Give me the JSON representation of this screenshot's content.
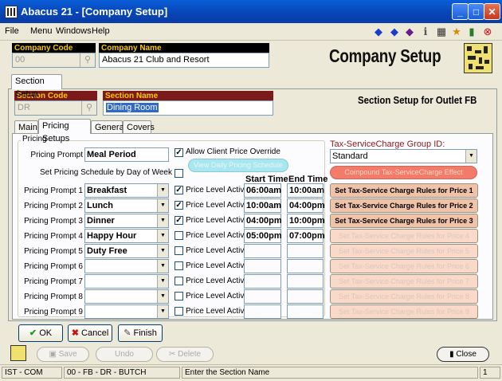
{
  "window": {
    "title": "Abacus 21 - [Company Setup]"
  },
  "menubar": {
    "items": [
      "File",
      "Menu",
      "Windows",
      "Help"
    ]
  },
  "company": {
    "code_label": "Company Code",
    "code_value": "00",
    "name_label": "Company Name",
    "name_value": "Abacus 21 Club and Resort",
    "page_title": "Company Setup"
  },
  "outer_tab": "Section Setup",
  "section": {
    "code_label": "Section Code",
    "code_value": "DR",
    "name_label": "Section Name",
    "name_value": "Dining Room",
    "subtitle": "Section Setup for Outlet FB"
  },
  "inner_tabs": [
    "Main",
    "Pricing Setups",
    "General",
    "Covers"
  ],
  "pricing": {
    "group_label": "Pricing",
    "prompt_label": "Pricing Prompt",
    "prompt_value": "Meal Period",
    "allow_override_label": "Allow Client Price Override",
    "allow_override_checked": true,
    "schedule_label": "Set Pricing Schedule by Day of Week",
    "schedule_checked": false,
    "view_schedule_button": "View Daily Pricing Schedule",
    "start_time_header": "Start Time",
    "end_time_header": "End Time",
    "level_active_label": "Price Level Active",
    "rows": [
      {
        "label": "Pricing Prompt 1",
        "value": "Breakfast",
        "active": true,
        "start": "06:00am",
        "end": "10:00am",
        "rule": "Set Tax-Service Charge Rules for Price 1",
        "rule_enabled": true
      },
      {
        "label": "Pricing Prompt 2",
        "value": "Lunch",
        "active": true,
        "start": "10:00am",
        "end": "04:00pm",
        "rule": "Set Tax-Service Charge Rules for Price 2",
        "rule_enabled": true
      },
      {
        "label": "Pricing Prompt 3",
        "value": "Dinner",
        "active": true,
        "start": "04:00pm",
        "end": "10:00pm",
        "rule": "Set Tax-Service Charge Rules for Price 3",
        "rule_enabled": true
      },
      {
        "label": "Pricing Prompt 4",
        "value": "Happy Hour",
        "active": false,
        "start": "05:00pm",
        "end": "07:00pm",
        "rule": "Set Tax-Service Charge Rules for Price 4",
        "rule_enabled": false
      },
      {
        "label": "Pricing Prompt 5",
        "value": "Duty Free",
        "active": false,
        "start": "",
        "end": "",
        "rule": "Set Tax-Service Charge Rules for Price 5",
        "rule_enabled": false
      },
      {
        "label": "Pricing Prompt 6",
        "value": "",
        "active": false,
        "start": "",
        "end": "",
        "rule": "Set Tax-Service Charge Rules for Price 6",
        "rule_enabled": false
      },
      {
        "label": "Pricing Prompt 7",
        "value": "",
        "active": false,
        "start": "",
        "end": "",
        "rule": "Set Tax-Service Charge Rules for Price 7",
        "rule_enabled": false
      },
      {
        "label": "Pricing Prompt 8",
        "value": "",
        "active": false,
        "start": "",
        "end": "",
        "rule": "Set Tax-Service Charge Rules for Price 8",
        "rule_enabled": false
      },
      {
        "label": "Pricing Prompt 9",
        "value": "",
        "active": false,
        "start": "",
        "end": "",
        "rule": "Set Tax-Service Charge Rules for Price 9",
        "rule_enabled": false
      }
    ]
  },
  "tax": {
    "group_label": "Tax-ServiceCharge Group ID:",
    "group_value": "Standard",
    "compound_button": "Compound Tax-ServiceCharge Effect"
  },
  "form_buttons": {
    "ok": "OK",
    "cancel": "Cancel",
    "finish": "Finish"
  },
  "toolbar": {
    "save": "Save",
    "undo": "Undo",
    "delete": "Delete",
    "close": "Close"
  },
  "statusbar": {
    "module": "IST - COM",
    "context": "00 - FB - DR - BUTCH",
    "message": "Enter the Section Name",
    "page": "1"
  },
  "colors": {
    "title_bar": "#0845b8",
    "header_label_bg": "#000000",
    "header_label_text": "#f8c800",
    "section_label_bg": "#7b1a1a",
    "compound_button": "#f47a6a",
    "view_button": "#a8e6f0"
  }
}
